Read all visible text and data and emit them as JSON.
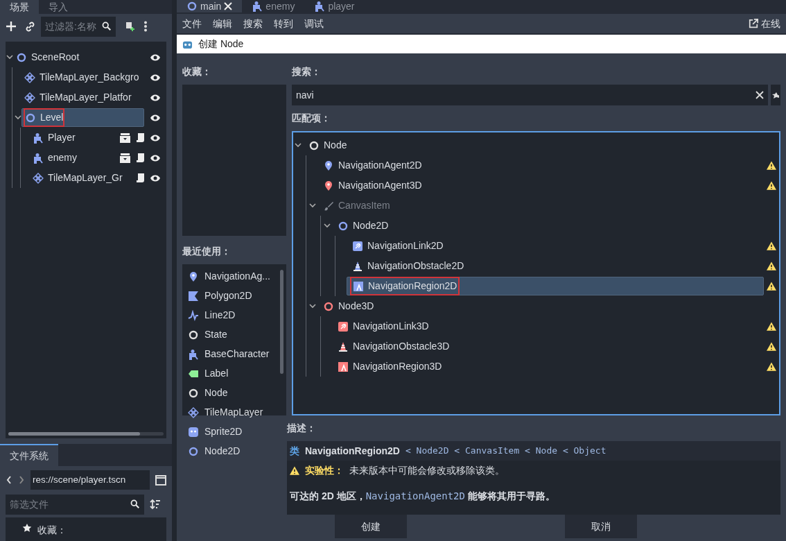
{
  "scene_dock": {
    "tabs": [
      {
        "label": "场景",
        "selected": true
      },
      {
        "label": "导入",
        "selected": false
      }
    ],
    "filter": {
      "placeholder": "过滤器:名称"
    },
    "tree": [
      {
        "name": "SceneRoot",
        "kind": "circle",
        "color": "#8da5f3",
        "selected": false,
        "annotated": false,
        "instance": false,
        "script": false,
        "visible": true,
        "expanded": true,
        "children": [
          {
            "name": "TileMapLayer_Backgro",
            "kind": "tiles",
            "color": "#8da5f3",
            "selected": false,
            "annotated": false,
            "instance": false,
            "script": false,
            "visible": true
          },
          {
            "name": "TileMapLayer_Platfor",
            "kind": "tiles",
            "color": "#8da5f3",
            "selected": false,
            "annotated": false,
            "instance": false,
            "script": false,
            "visible": true
          },
          {
            "name": "Level",
            "kind": "circle",
            "color": "#8da5f3",
            "selected": true,
            "annotated": true,
            "instance": false,
            "script": false,
            "visible": true,
            "expanded": true,
            "children": [
              {
                "name": "Player",
                "kind": "figure",
                "color": "#8da5f3",
                "selected": false,
                "annotated": false,
                "instance": true,
                "script": true,
                "visible": true
              },
              {
                "name": "enemy",
                "kind": "figure",
                "color": "#8da5f3",
                "selected": false,
                "annotated": false,
                "instance": true,
                "script": true,
                "visible": true
              },
              {
                "name": "TileMapLayer_Gr",
                "kind": "tiles",
                "color": "#8da5f3",
                "selected": false,
                "annotated": false,
                "instance": false,
                "script": true,
                "visible": true
              }
            ]
          }
        ]
      }
    ]
  },
  "filesystem": {
    "tabs": [
      {
        "label": "文件系统",
        "selected": true
      }
    ],
    "path": "res://scene/player.tscn",
    "filter": {
      "placeholder": "筛选文件"
    },
    "favorites": "收藏："
  },
  "editor_tabs": [
    {
      "label": "main",
      "kind": "circle",
      "color": "#8da5f3",
      "selected": true
    },
    {
      "label": "enemy",
      "kind": "figure",
      "color": "#8da5f3",
      "selected": false
    },
    {
      "label": "player",
      "kind": "figure",
      "color": "#8da5f3",
      "selected": false
    }
  ],
  "menu": [
    "文件",
    "编辑",
    "搜索",
    "转到",
    "调试"
  ],
  "online_docs": "在线",
  "dialog": {
    "title": "创建 Node",
    "favorites_label": "收藏：",
    "recent_label": "最近使用：",
    "recent": [
      {
        "name": "NavigationAg...",
        "kind": "pin",
        "color": "#8da5f3"
      },
      {
        "name": "Polygon2D",
        "kind": "polygon",
        "color": "#8da5f3"
      },
      {
        "name": "Line2D",
        "kind": "line",
        "color": "#8da5f3"
      },
      {
        "name": "State",
        "kind": "circle",
        "color": "#e0e0e0"
      },
      {
        "name": "BaseCharacter",
        "kind": "figure",
        "color": "#8da5f3"
      },
      {
        "name": "Label",
        "kind": "tag",
        "color": "#8eef97"
      },
      {
        "name": "Node",
        "kind": "circle",
        "color": "#e0e0e0"
      },
      {
        "name": "TileMapLayer",
        "kind": "tiles",
        "color": "#8da5f3"
      },
      {
        "name": "Sprite2D",
        "kind": "face",
        "color": "#8da5f3"
      },
      {
        "name": "Node2D",
        "kind": "circle",
        "color": "#8da5f3"
      }
    ],
    "search_label": "搜索：",
    "search": {
      "value": "navi"
    },
    "matches_label": "匹配项：",
    "matches": [
      {
        "name": "Node",
        "kind": "circle",
        "color": "#e0e0e0",
        "selected": false,
        "annotated": false,
        "disabled": false,
        "warning": false,
        "expanded": true,
        "children": [
          {
            "name": "NavigationAgent2D",
            "kind": "pin",
            "color": "#8da5f3",
            "selected": false,
            "annotated": false,
            "disabled": false,
            "warning": true
          },
          {
            "name": "NavigationAgent3D",
            "kind": "pin",
            "color": "#fc7f7f",
            "selected": false,
            "annotated": false,
            "disabled": false,
            "warning": true
          },
          {
            "name": "CanvasItem",
            "kind": "brush",
            "color": "#8a8f99",
            "selected": false,
            "annotated": false,
            "disabled": true,
            "warning": false,
            "expanded": true,
            "children": [
              {
                "name": "Node2D",
                "kind": "circle",
                "color": "#8da5f3",
                "selected": false,
                "annotated": false,
                "disabled": false,
                "warning": false,
                "expanded": true,
                "children": [
                  {
                    "name": "NavigationLink2D",
                    "kind": "link",
                    "color": "#8da5f3",
                    "selected": false,
                    "annotated": false,
                    "disabled": false,
                    "warning": true
                  },
                  {
                    "name": "NavigationObstacle2D",
                    "kind": "cone",
                    "color": "#8da5f3",
                    "selected": false,
                    "annotated": false,
                    "disabled": false,
                    "warning": true
                  },
                  {
                    "name": "NavigationRegion2D",
                    "kind": "region",
                    "color": "#8da5f3",
                    "selected": true,
                    "annotated": true,
                    "disabled": false,
                    "warning": true
                  }
                ]
              }
            ]
          },
          {
            "name": "Node3D",
            "kind": "circle",
            "color": "#fc7f7f",
            "selected": false,
            "annotated": false,
            "disabled": false,
            "warning": false,
            "expanded": true,
            "children": [
              {
                "name": "NavigationLink3D",
                "kind": "link",
                "color": "#fc7f7f",
                "selected": false,
                "annotated": false,
                "disabled": false,
                "warning": true
              },
              {
                "name": "NavigationObstacle3D",
                "kind": "cone",
                "color": "#fc7f7f",
                "selected": false,
                "annotated": false,
                "disabled": false,
                "warning": true
              },
              {
                "name": "NavigationRegion3D",
                "kind": "region",
                "color": "#fc7f7f",
                "selected": false,
                "annotated": false,
                "disabled": false,
                "warning": true
              }
            ]
          }
        ]
      }
    ],
    "description_label": "描述：",
    "description": {
      "class_word": "类",
      "class_name": "NavigationRegion2D",
      "separator": "<",
      "inheritance": [
        "Node2D",
        "CanvasItem",
        "Node",
        "Object"
      ],
      "experimental_label": "实验性：",
      "experimental_text": "未来版本中可能会修改或移除该类。",
      "text_before": "可达的 2D 地区，",
      "link": "NavigationAgent2D",
      "text_after": " 能够将其用于寻路。"
    },
    "buttons": [
      "创建",
      "取消"
    ]
  }
}
